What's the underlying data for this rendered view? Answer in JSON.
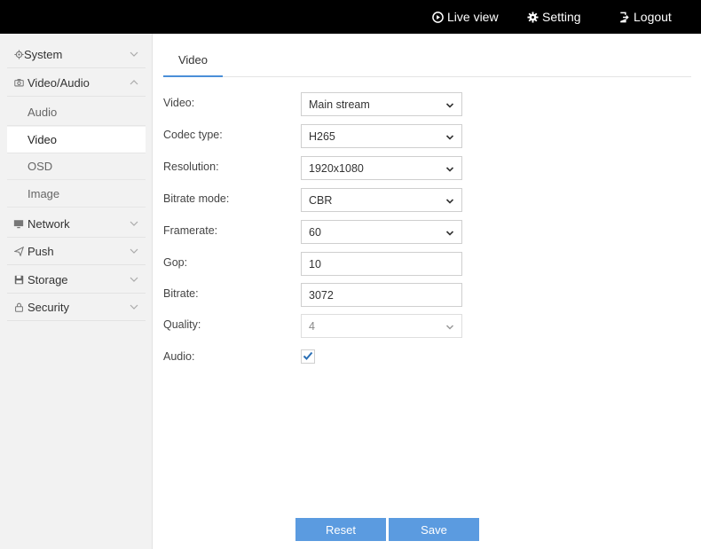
{
  "topnav": {
    "live_view": "Live view",
    "setting": "Setting",
    "logout": "Logout"
  },
  "sidebar": {
    "system": "System",
    "video_audio": "Video/Audio",
    "sub": [
      "Audio",
      "Video",
      "OSD",
      "Image"
    ],
    "network": "Network",
    "push": "Push",
    "storage": "Storage",
    "security": "Security"
  },
  "main": {
    "tab": "Video",
    "fields": {
      "video_label": "Video:",
      "video_value": "Main stream",
      "codec_label": "Codec type:",
      "codec_value": "H265",
      "resolution_label": "Resolution:",
      "resolution_value": "1920x1080",
      "bitrate_mode_label": "Bitrate mode:",
      "bitrate_mode_value": "CBR",
      "framerate_label": "Framerate:",
      "framerate_value": "60",
      "gop_label": "Gop:",
      "gop_value": "10",
      "bitrate_label": "Bitrate:",
      "bitrate_value": "3072",
      "quality_label": "Quality:",
      "quality_value": "4",
      "audio_label": "Audio:",
      "audio_checked": true
    },
    "buttons": {
      "reset": "Reset",
      "save": "Save"
    }
  },
  "colors": {
    "accent": "#5b9be0",
    "topbar": "#000000",
    "check": "#2a6fb5"
  }
}
